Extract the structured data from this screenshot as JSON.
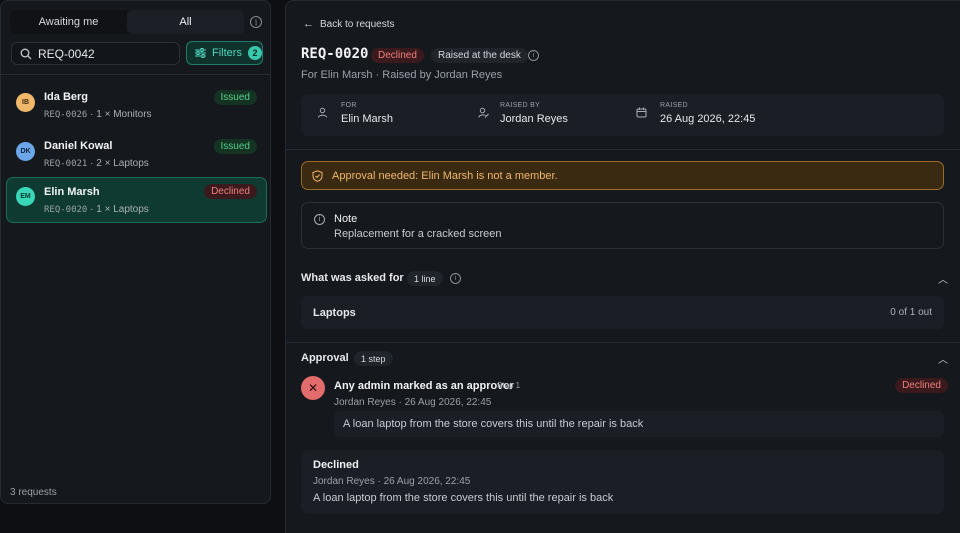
{
  "sidebar": {
    "tabs": [
      {
        "label": "Awaiting me",
        "active": false
      },
      {
        "label": "All",
        "active": true
      }
    ],
    "search": {
      "value": "REQ-0042",
      "placeholder": ""
    },
    "filters": {
      "label": "Filters",
      "count": "2"
    },
    "requests": [
      {
        "initials": "IB",
        "avatar_color": "#f0b86b",
        "name": "Ida Berg",
        "id": "REQ-0026",
        "summary": "1 × Monitors",
        "status": "Issued",
        "selected": false
      },
      {
        "initials": "DK",
        "avatar_color": "#6aa6e8",
        "name": "Daniel Kowal",
        "id": "REQ-0021",
        "summary": "2 × Laptops",
        "status": "Issued",
        "selected": false
      },
      {
        "initials": "EM",
        "avatar_color": "#3ad6b8",
        "name": "Elin Marsh",
        "id": "REQ-0020",
        "summary": "1 × Laptops",
        "status": "Declined",
        "selected": true
      }
    ],
    "footer": "3 requests"
  },
  "detail": {
    "back_label": "Back to requests",
    "req_id": "REQ-0020",
    "status": "Declined",
    "channel": "Raised at the desk",
    "subline": "For Elin Marsh · Raised by Jordan Reyes",
    "meta": {
      "for_label": "FOR",
      "for_value": "Elin Marsh",
      "raised_by_label": "RAISED BY",
      "raised_by_value": "Jordan Reyes",
      "raised_label": "RAISED",
      "raised_value": "26 Aug 2026, 22:45"
    },
    "alert": "Approval needed: Elin Marsh is not a member.",
    "note": {
      "title": "Note",
      "body": "Replacement for a cracked screen"
    },
    "asked": {
      "title": "What was asked for",
      "count": "1 line",
      "line_name": "Laptops",
      "line_count": "0 of 1 out"
    },
    "approval": {
      "title": "Approval",
      "count": "1 step",
      "step_title": "Any admin marked as an approver",
      "step_num": "Step 1",
      "step_status": "Declined",
      "step_meta": "Jordan Reyes · 26 Aug 2026, 22:45",
      "step_comment": "A loan laptop from the store covers this until the repair is back"
    },
    "decision": {
      "title": "Declined",
      "meta": "Jordan Reyes · 26 Aug 2026, 22:45",
      "comment": "A loan laptop from the store covers this until the repair is back"
    }
  },
  "colors": {
    "accent": "#38c9ac",
    "declined": "#f07f7f",
    "issued": "#55d08a",
    "warning": "#f0b66a"
  }
}
